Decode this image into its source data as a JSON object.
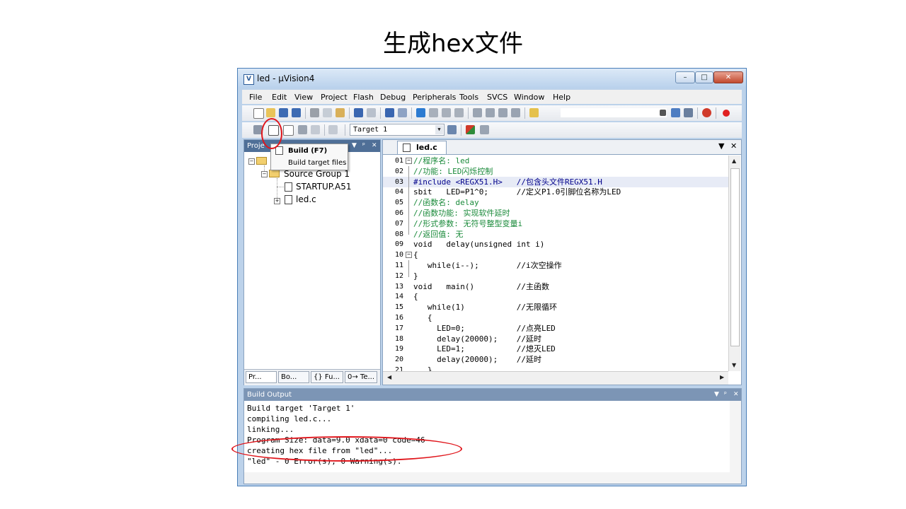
{
  "slide_title": "生成hex文件",
  "window": {
    "title": "led  - µVision4",
    "controls": [
      "–",
      "□",
      "✕"
    ]
  },
  "menu": [
    "File",
    "Edit",
    "View",
    "Project",
    "Flash",
    "Debug",
    "Peripherals",
    "Tools",
    "SVCS",
    "Window",
    "Help"
  ],
  "toolbar": {
    "target_select": "Target 1"
  },
  "tooltip": {
    "title": "Build (F7)",
    "description": "Build target files"
  },
  "project_pane": {
    "header": "Proje",
    "tree": {
      "group": "Source Group 1",
      "files": [
        "STARTUP.A51",
        "led.c"
      ]
    },
    "tabs": [
      "Pr...",
      "Bo...",
      "{} Fu...",
      "0→ Te..."
    ]
  },
  "editor": {
    "tab": "led.c",
    "lines": [
      {
        "n": "01",
        "text": "//程序名: led"
      },
      {
        "n": "02",
        "text": "//功能: LED闪烁控制"
      },
      {
        "n": "03",
        "text": "#include <REGX51.H>   //包含头文件REGX51.H"
      },
      {
        "n": "04",
        "text": "sbit   LED=P1^0;      //定义P1.0引脚位名称为LED"
      },
      {
        "n": "05",
        "text": "//函数名: delay"
      },
      {
        "n": "06",
        "text": "//函数功能: 实现软件延时"
      },
      {
        "n": "07",
        "text": "//形式参数: 无符号整型变量i"
      },
      {
        "n": "08",
        "text": "//返回值: 无"
      },
      {
        "n": "09",
        "text": "void   delay(unsigned int i)"
      },
      {
        "n": "10",
        "text": "{"
      },
      {
        "n": "11",
        "text": "   while(i--);        //i次空操作"
      },
      {
        "n": "12",
        "text": "}"
      },
      {
        "n": "13",
        "text": "void   main()         //主函数"
      },
      {
        "n": "14",
        "text": "{"
      },
      {
        "n": "15",
        "text": "   while(1)           //无限循环"
      },
      {
        "n": "16",
        "text": "   {"
      },
      {
        "n": "17",
        "text": "     LED=0;           //点亮LED"
      },
      {
        "n": "18",
        "text": "     delay(20000);    //延时"
      },
      {
        "n": "19",
        "text": "     LED=1;           //熄灭LED"
      },
      {
        "n": "20",
        "text": "     delay(20000);    //延时"
      },
      {
        "n": "21",
        "text": "   }"
      }
    ]
  },
  "build_output": {
    "header": "Build Output",
    "lines": [
      "Build target 'Target 1'",
      "compiling led.c...",
      "linking...",
      "Program Size: data=9.0 xdata=0 code=46",
      "creating hex file from \"led\"...",
      "\"led\" - 0 Error(s), 0 Warning(s)."
    ]
  },
  "colors": {
    "annotation": "#e0161c",
    "titlebar": "#bcd2ea",
    "comment": "#1a8a3a"
  }
}
